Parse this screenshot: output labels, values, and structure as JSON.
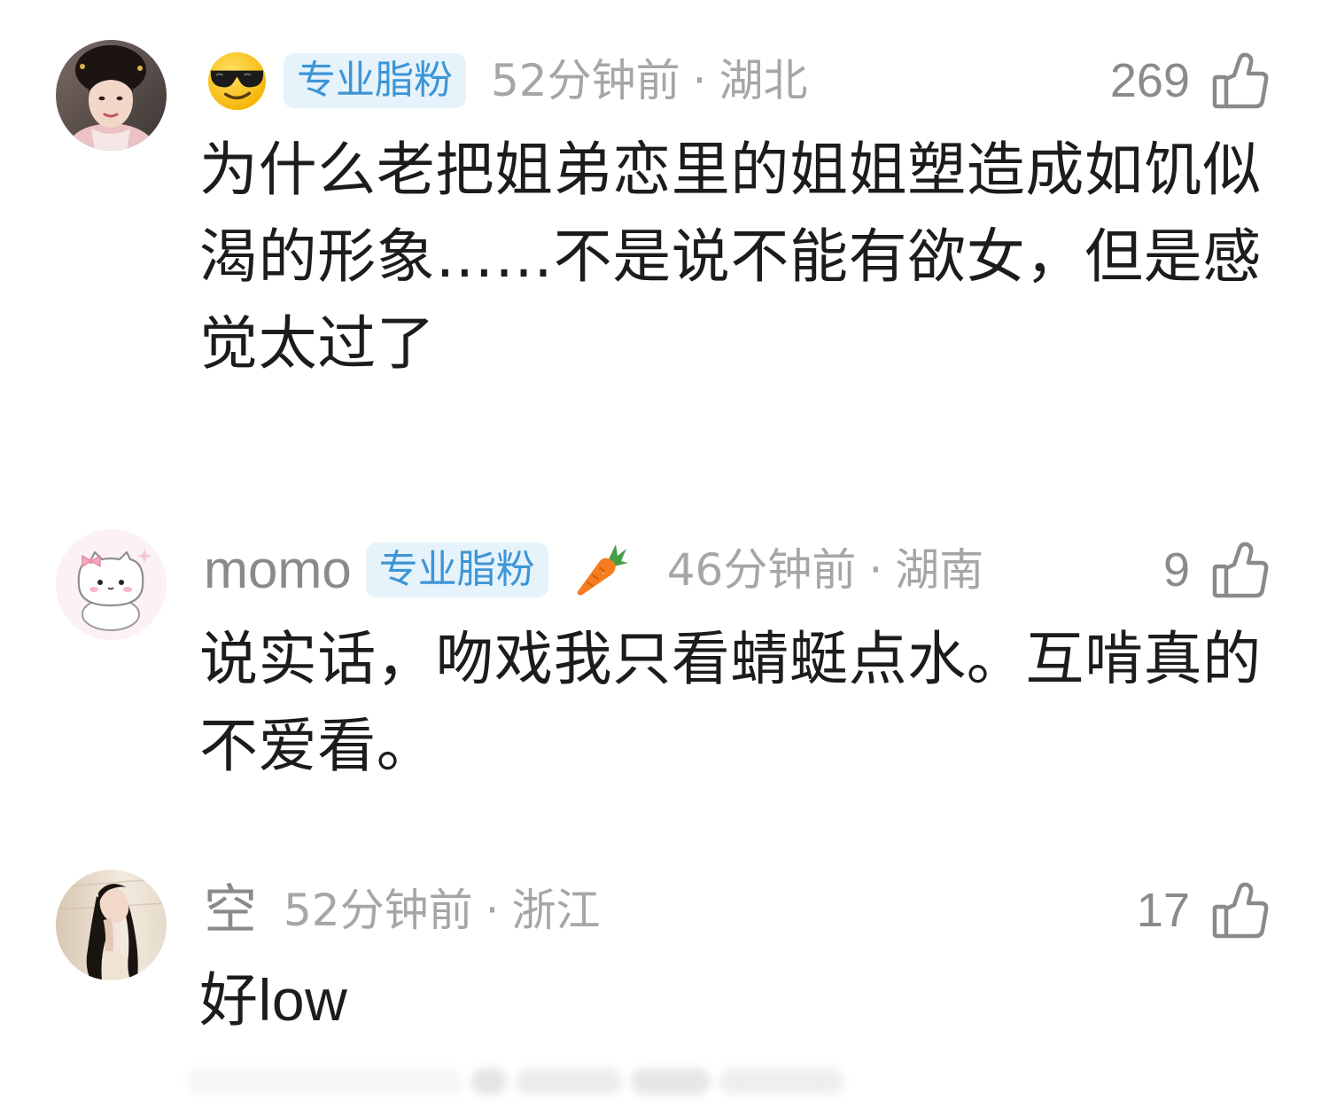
{
  "ui": {
    "meta_separator": "·",
    "like_icon": "thumbs-up-icon"
  },
  "colors": {
    "badge_bg": "#e6f3fb",
    "badge_text": "#3d95d6",
    "meta": "#a6a6a6",
    "username": "#8a8a8a",
    "content": "#1c1c1c",
    "like": "#8a8a8a",
    "page_bg": "#ffffff"
  },
  "comments": [
    {
      "user": {
        "name_icon": "smiling-face-with-sunglasses-icon",
        "avatar_icon": "woman-portrait-avatar-icon"
      },
      "badge": "专业脂粉",
      "time": "52分钟前",
      "location": "湖北",
      "likes": 269,
      "content_lines": [
        "为什么老把姐弟恋里的姐姐塑造成如饥似",
        "渴的形象……不是说不能有欲女，但是感",
        "觉太过了"
      ]
    },
    {
      "user": {
        "name": "momo",
        "avatar_icon": "white-cat-cartoon-avatar-icon",
        "extra_icon": "carrot-icon"
      },
      "badge": "专业脂粉",
      "time": "46分钟前",
      "location": "湖南",
      "likes": 9,
      "content_lines": [
        "说实话，吻戏我只看蜻蜓点水。互啃真的",
        "不爱看。"
      ]
    },
    {
      "user": {
        "name": "空",
        "avatar_icon": "long-hair-woman-avatar-icon"
      },
      "time": "52分钟前",
      "location": "浙江",
      "likes": 17,
      "content_lines": [
        "好low"
      ]
    }
  ]
}
